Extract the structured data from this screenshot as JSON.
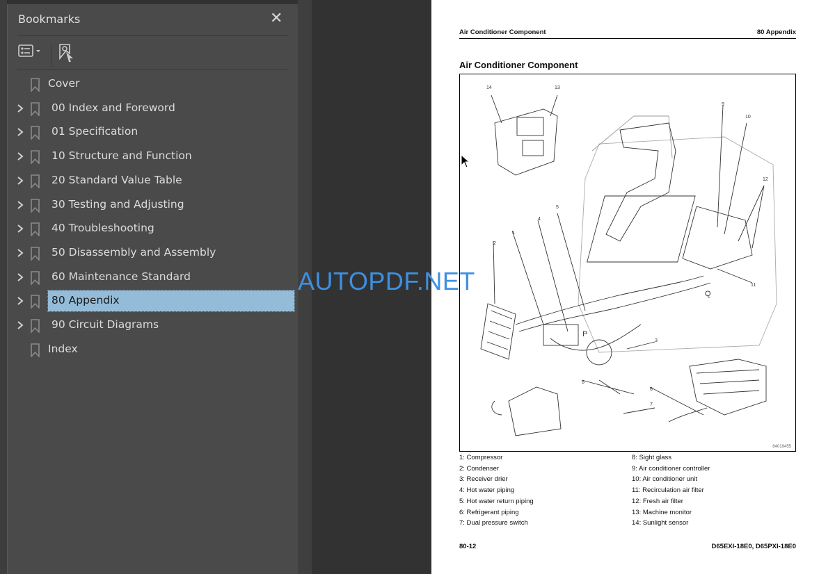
{
  "bookmarks_panel": {
    "title": "Bookmarks",
    "close_icon": "close-icon",
    "tools": [
      "bookmark-options-icon",
      "find-current-bookmark-icon"
    ],
    "items": [
      {
        "label": "Cover",
        "expandable": false,
        "selected": false
      },
      {
        "label": "00 Index and Foreword",
        "expandable": true,
        "selected": false
      },
      {
        "label": "01 Specification",
        "expandable": true,
        "selected": false
      },
      {
        "label": "10 Structure and Function",
        "expandable": true,
        "selected": false
      },
      {
        "label": "20 Standard Value Table",
        "expandable": true,
        "selected": false
      },
      {
        "label": "30 Testing and Adjusting",
        "expandable": true,
        "selected": false
      },
      {
        "label": "40 Troubleshooting",
        "expandable": true,
        "selected": false
      },
      {
        "label": "50 Disassembly and Assembly",
        "expandable": true,
        "selected": false
      },
      {
        "label": "60 Maintenance Standard",
        "expandable": true,
        "selected": false
      },
      {
        "label": "80 Appendix",
        "expandable": true,
        "selected": true
      },
      {
        "label": "90 Circuit Diagrams",
        "expandable": true,
        "selected": false
      },
      {
        "label": "Index",
        "expandable": false,
        "selected": false
      }
    ],
    "selected_color": "#94bcd8"
  },
  "watermark": "AUTOPDF.NET",
  "page": {
    "header_left": "Air Conditioner Component",
    "header_right": "80 Appendix",
    "title": "Air Conditioner Component",
    "figure_id": "84019455",
    "figure_labels": [
      "1",
      "2",
      "3",
      "4",
      "5",
      "6",
      "7",
      "8",
      "9",
      "10",
      "11",
      "12",
      "13",
      "14",
      "P",
      "Q"
    ],
    "legend_left": [
      "1: Compressor",
      "2: Condenser",
      "3: Receiver drier",
      "4: Hot water piping",
      "5: Hot water return piping",
      "6: Refrigerant piping",
      "7: Dual pressure switch"
    ],
    "legend_right": [
      "8: Sight glass",
      "9: Air conditioner controller",
      "10: Air conditioner unit",
      "11: Recirculation air filter",
      "12: Fresh air filter",
      "13: Machine monitor",
      "14: Sunlight sensor"
    ],
    "footer_left": "80-12",
    "footer_right": "D65EXI-18E0, D65PXI-18E0"
  }
}
